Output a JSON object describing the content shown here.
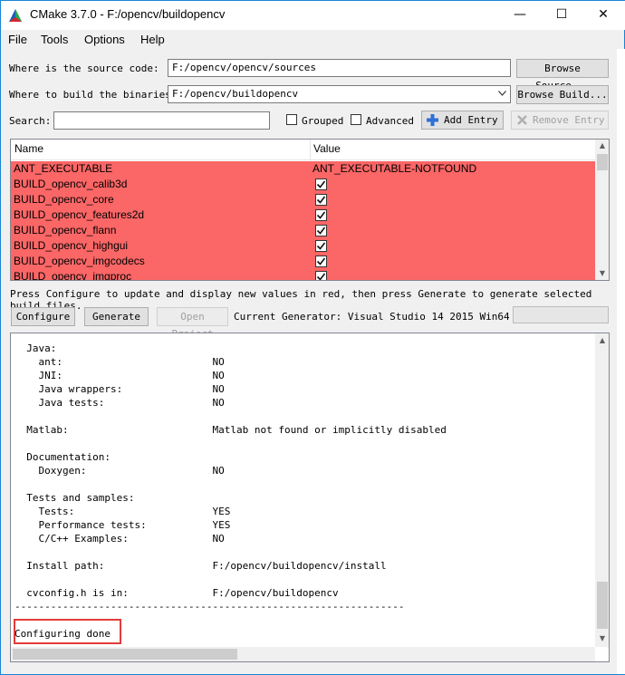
{
  "window": {
    "title": "CMake 3.7.0 - F:/opencv/buildopencv",
    "minimize_glyph": "—",
    "maximize_glyph": "☐",
    "close_glyph": "✕"
  },
  "menu": [
    "File",
    "Tools",
    "Options",
    "Help"
  ],
  "source": {
    "label": "Where is the source code:",
    "value": "F:/opencv/opencv/sources",
    "browse_label": "Browse Source..."
  },
  "build": {
    "label": "Where to build the binaries:",
    "value": "F:/opencv/buildopencv",
    "browse_label": "Browse Build..."
  },
  "search": {
    "label": "Search:",
    "value": "",
    "grouped_label": "Grouped",
    "advanced_label": "Advanced",
    "add_entry_label": "Add Entry",
    "remove_entry_label": "Remove Entry"
  },
  "table": {
    "headers": [
      "Name",
      "Value"
    ],
    "rows": [
      {
        "name": "ANT_EXECUTABLE",
        "value": "ANT_EXECUTABLE-NOTFOUND",
        "checkbox": false
      },
      {
        "name": "BUILD_opencv_calib3d",
        "value": "",
        "checkbox": true
      },
      {
        "name": "BUILD_opencv_core",
        "value": "",
        "checkbox": true
      },
      {
        "name": "BUILD_opencv_features2d",
        "value": "",
        "checkbox": true
      },
      {
        "name": "BUILD_opencv_flann",
        "value": "",
        "checkbox": true
      },
      {
        "name": "BUILD_opencv_highgui",
        "value": "",
        "checkbox": true
      },
      {
        "name": "BUILD_opencv_imgcodecs",
        "value": "",
        "checkbox": true
      },
      {
        "name": "BUILD_opencv_imgproc",
        "value": "",
        "checkbox": true
      }
    ],
    "row_color": "#fb6666"
  },
  "hint": "Press Configure to update and display new values in red, then press Generate to generate selected build files.",
  "actions": {
    "configure_label": "Configure",
    "generate_label": "Generate",
    "open_project_label": "Open Project",
    "generator_text": "Current Generator: Visual Studio 14 2015 Win64"
  },
  "output_lines": [
    "  Java:",
    "    ant:                         NO",
    "    JNI:                         NO",
    "    Java wrappers:               NO",
    "    Java tests:                  NO",
    "",
    "  Matlab:                        Matlab not found or implicitly disabled",
    "",
    "  Documentation:",
    "    Doxygen:                     NO",
    "",
    "  Tests and samples:",
    "    Tests:                       YES",
    "    Performance tests:           YES",
    "    C/C++ Examples:              NO",
    "",
    "  Install path:                  F:/opencv/buildopencv/install",
    "",
    "  cvconfig.h is in:              F:/opencv/buildopencv",
    "-----------------------------------------------------------------",
    "",
    "Configuring done"
  ]
}
